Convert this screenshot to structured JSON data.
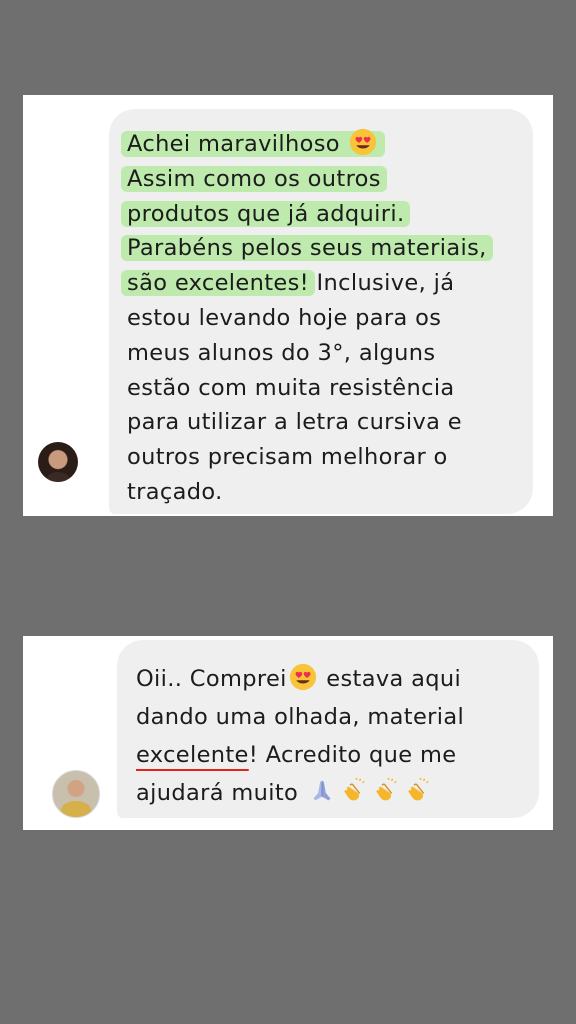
{
  "screenshot_1": {
    "lines": [
      {
        "a": "Achei maravilhoso",
        "b": ""
      },
      {
        "a": "Assim como os outros",
        "b": ""
      },
      {
        "a": "produtos que já adquiri.",
        "b": ""
      },
      {
        "a": "Parabéns pelos seus materiais,",
        "b": ""
      },
      {
        "a": "são excelentes!",
        "b": " Inclusive, já"
      },
      {
        "a": "estou levando hoje para os",
        "b": ""
      },
      {
        "a": "meus alunos do 3°, alguns",
        "b": ""
      },
      {
        "a": "estão com muita resistência",
        "b": ""
      },
      {
        "a": "para utilizar a letra cursiva e",
        "b": ""
      },
      {
        "a": "outros precisam melhorar o",
        "b": ""
      },
      {
        "a": "traçado.",
        "b": ""
      }
    ],
    "emoji_after_line1": "heart-eyes-emoji",
    "highlight_color": "#96e678"
  },
  "screenshot_2": {
    "line1_a": "Oii.. Comprei",
    "line1_b": " estava aqui",
    "line2": "dando uma olhada, material",
    "line3_underlined": "excelente",
    "line3_rest": "! Acredito que me",
    "line4": "ajudará muito ",
    "emojis": [
      "heart-eyes-emoji",
      "folded-hands-emoji",
      "clapping-hands-emoji",
      "clapping-hands-emoji",
      "clapping-hands-emoji"
    ],
    "underline_color": "#e0241b"
  },
  "colors": {
    "background": "#6f6f6f",
    "card": "#ffffff",
    "bubble": "#efefef",
    "text": "#1c1c1c"
  }
}
